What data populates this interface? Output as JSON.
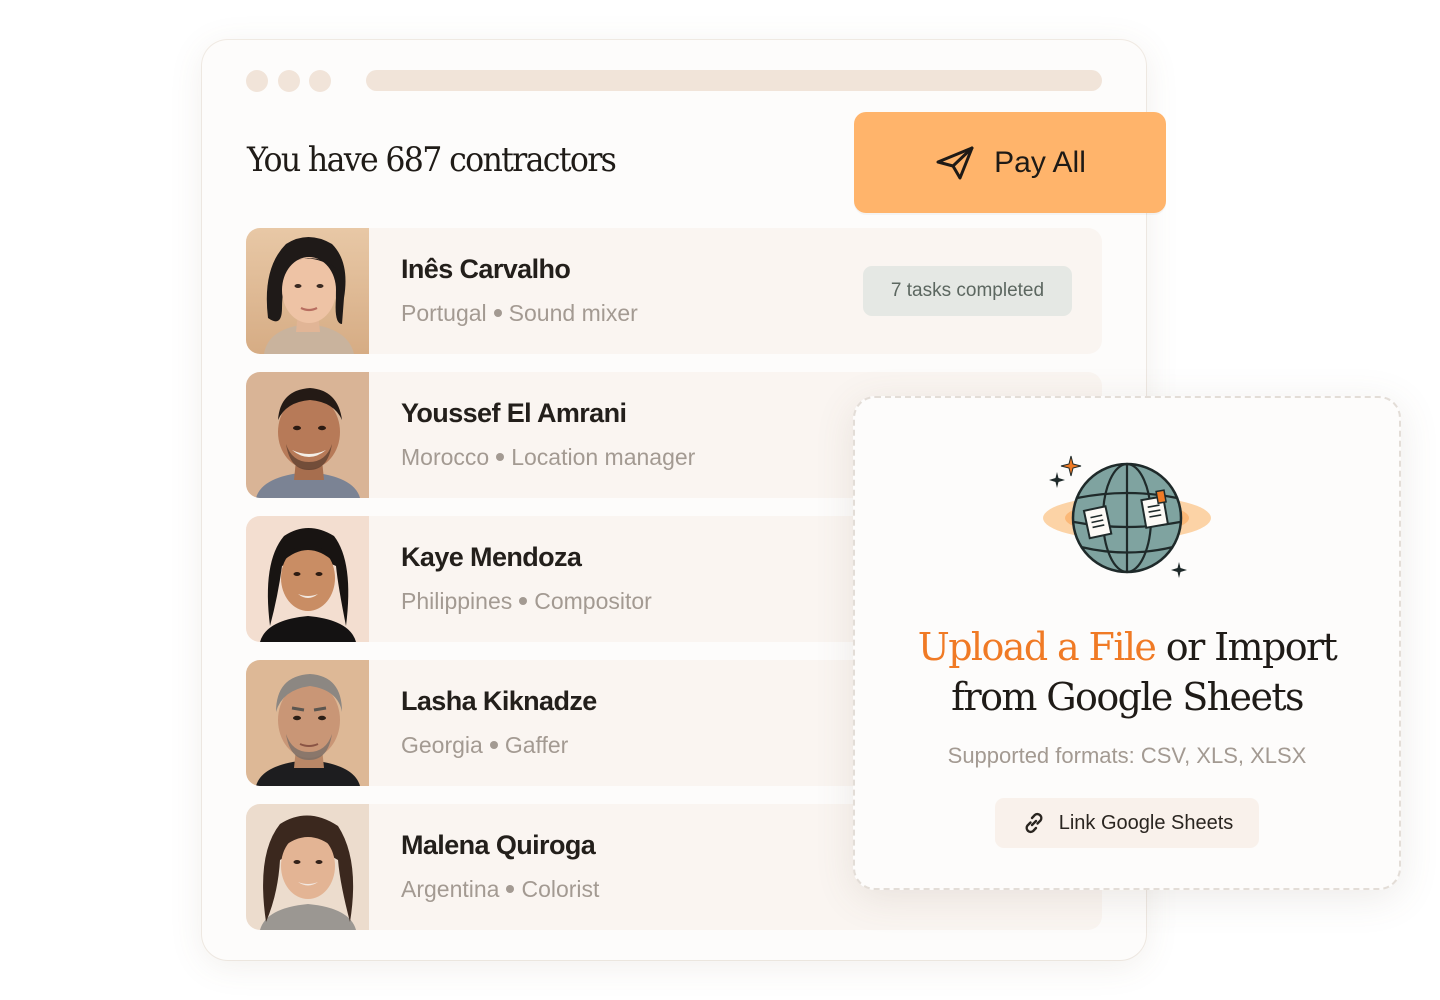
{
  "window": {
    "headline": "You have 687 contractors",
    "pay_all_label": "Pay All"
  },
  "contractors": [
    {
      "name": "Inês Carvalho",
      "country": "Portugal",
      "role": "Sound mixer",
      "badge": "7 tasks completed"
    },
    {
      "name": "Youssef El Amrani",
      "country": "Morocco",
      "role": "Location manager"
    },
    {
      "name": "Kaye Mendoza",
      "country": "Philippines",
      "role": "Compositor"
    },
    {
      "name": "Lasha Kiknadze",
      "country": "Georgia",
      "role": "Gaffer"
    },
    {
      "name": "Malena Quiroga",
      "country": "Argentina",
      "role": "Colorist"
    }
  ],
  "upload": {
    "title_accent": "Upload a File",
    "title_rest": " or Import",
    "title_line2": "from Google Sheets",
    "formats": "Supported formats: CSV, XLS, XLSX",
    "link_label": "Link Google Sheets"
  },
  "colors": {
    "accent_orange": "#f07a25",
    "button_orange": "#ffb46b",
    "row_bg": "#faf5f1",
    "muted_text": "#a39a92"
  },
  "icons": {
    "pay": "paper-plane-icon",
    "link": "chain-link-icon",
    "upload": "globe-documents-icon"
  }
}
